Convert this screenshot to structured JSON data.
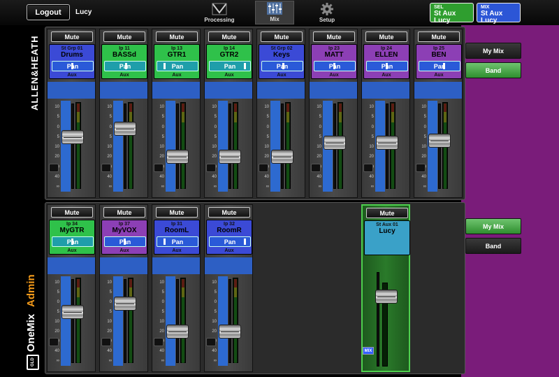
{
  "topbar": {
    "logout_label": "Logout",
    "user": "Lucy",
    "tabs": [
      {
        "label": "Processing",
        "icon": "processing-icon",
        "active": false
      },
      {
        "label": "Mix",
        "icon": "mix-icon",
        "active": true
      },
      {
        "label": "Setup",
        "icon": "gear-icon",
        "active": false
      }
    ],
    "sel_button": {
      "small": "SEL",
      "large": "St Aux Lucy",
      "color": "#2f9e2f"
    },
    "mix_button": {
      "small": "MIX",
      "large": "St Aux Lucy",
      "color": "#2c56d6"
    }
  },
  "branding": {
    "maker": "ALLEN&HEATH",
    "product": "OneMix",
    "role": "Admin",
    "logo": "GLD"
  },
  "scale_labels": [
    "10",
    "5",
    "0",
    "5",
    "10",
    "20",
    "30",
    "40",
    "∞"
  ],
  "top_bank": {
    "strips": [
      {
        "mute": "Mute",
        "source": "St Grp 01",
        "name": "Drums",
        "pan": "Pan",
        "pan_pos": 0.45,
        "aux": "Aux",
        "color": "#3b4ad6",
        "pan_color": "#2a5ad8",
        "fader": 0.62
      },
      {
        "mute": "Mute",
        "source": "Ip 11",
        "name": "BASSd",
        "pan": "Pan",
        "pan_pos": 0.5,
        "aux": "Aux",
        "color": "#2fc14a",
        "pan_color": "#1f9eaa",
        "fader": 0.73
      },
      {
        "mute": "Mute",
        "source": "Ip 13",
        "name": "GTR1",
        "pan": "Pan",
        "pan_pos": 0.1,
        "aux": "Aux",
        "color": "#2fc14a",
        "pan_color": "#1f9eaa",
        "fader": 0.36
      },
      {
        "mute": "Mute",
        "source": "Ip 14",
        "name": "GTR2",
        "pan": "Pan",
        "pan_pos": 0.9,
        "aux": "Aux",
        "color": "#2fc14a",
        "pan_color": "#1f9eaa",
        "fader": 0.36
      },
      {
        "mute": "Mute",
        "source": "St Grp 02",
        "name": "Keys",
        "pan": "Pan",
        "pan_pos": 0.5,
        "aux": "Aux",
        "color": "#3b4ad6",
        "pan_color": "#2a5ad8",
        "fader": 0.36
      },
      {
        "mute": "Mute",
        "source": "Ip 23",
        "name": "MATT",
        "pan": "Pan",
        "pan_pos": 0.45,
        "aux": "Aux",
        "color": "#8c3fb5",
        "pan_color": "#2a5ad8",
        "fader": 0.55
      },
      {
        "mute": "Mute",
        "source": "Ip 24",
        "name": "ELLEN",
        "pan": "Pan",
        "pan_pos": 0.45,
        "aux": "Aux",
        "color": "#8c3fb5",
        "pan_color": "#2a5ad8",
        "fader": 0.55
      },
      {
        "mute": "Mute",
        "source": "Ip 25",
        "name": "BEN",
        "pan": "Pan",
        "pan_pos": 0.6,
        "aux": "Aux",
        "color": "#8c3fb5",
        "pan_color": "#2a5ad8",
        "fader": 0.57
      }
    ],
    "buttons": [
      {
        "label": "My Mix",
        "active": false
      },
      {
        "label": "Band",
        "active": true
      }
    ]
  },
  "bottom_bank": {
    "strips": [
      {
        "mute": "Mute",
        "source": "Ip 34",
        "name": "MyGTR",
        "pan": "Pan",
        "pan_pos": 0.45,
        "aux": "Aux",
        "color": "#2fc14a",
        "pan_color": "#1f9eaa",
        "fader": 0.62
      },
      {
        "mute": "Mute",
        "source": "Ip 37",
        "name": "MyVOX",
        "pan": "Pan",
        "pan_pos": 0.45,
        "aux": "Aux",
        "color": "#8c3fb5",
        "pan_color": "#2a5ad8",
        "fader": 0.73
      },
      {
        "mute": "Mute",
        "source": "Ip 31",
        "name": "RoomL",
        "pan": "Pan",
        "pan_pos": 0.1,
        "aux": "Aux",
        "color": "#3b4ad6",
        "pan_color": "#2a5ad8",
        "fader": 0.36
      },
      {
        "mute": "Mute",
        "source": "Ip 32",
        "name": "RoomR",
        "pan": "Pan",
        "pan_pos": 0.9,
        "aux": "Aux",
        "color": "#3b4ad6",
        "pan_color": "#2a5ad8",
        "fader": 0.36
      }
    ],
    "master": {
      "mute": "Mute",
      "source": "St Aux 01",
      "name": "Lucy",
      "color": "#3aa1c8",
      "fader": 0.78,
      "badge": "MIX"
    },
    "buttons": [
      {
        "label": "My Mix",
        "active": true
      },
      {
        "label": "Band",
        "active": false
      }
    ]
  }
}
